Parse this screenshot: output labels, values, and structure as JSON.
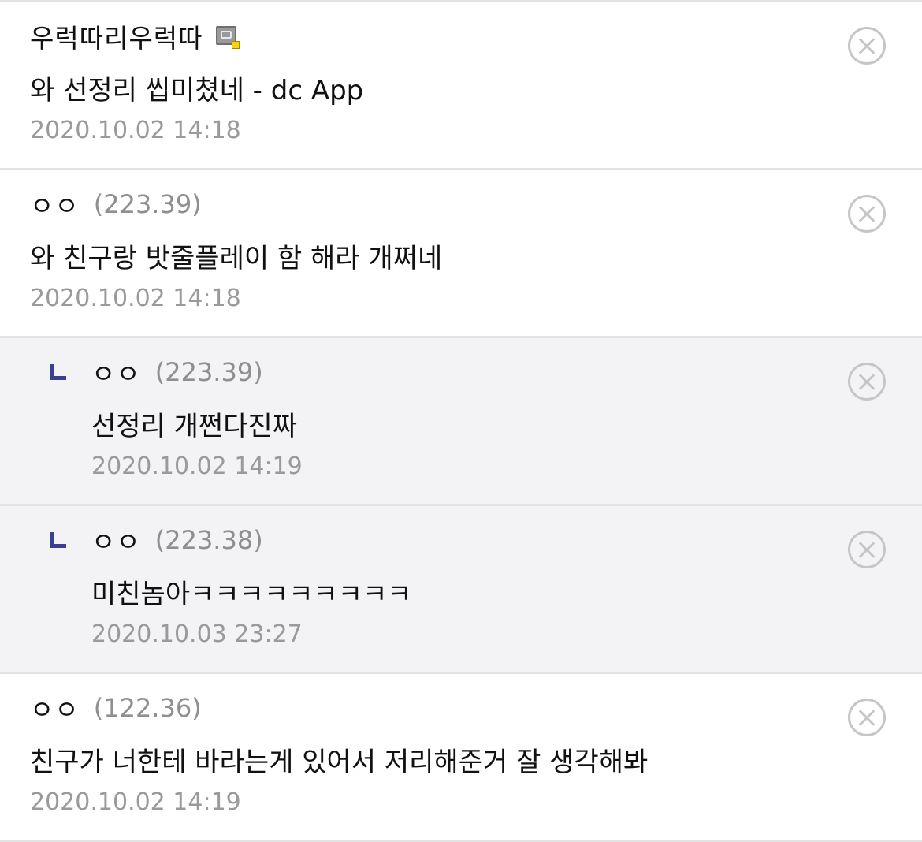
{
  "comments": [
    {
      "nickname": "우럭따리우럭따",
      "ip": "",
      "has_gallog_icon": true,
      "icon": "gallog-icon",
      "text": "와 선정리 씹미쳤네 - dc App",
      "date": "2020.10.02 14:18",
      "is_reply": false
    },
    {
      "nickname": "ㅇㅇ",
      "ip": "(223.39)",
      "text": "와 친구랑 밧줄플레이 함 해라 개쩌네",
      "date": "2020.10.02 14:18",
      "is_reply": false
    },
    {
      "nickname": "ㅇㅇ",
      "ip": "(223.39)",
      "text": "선정리 개쩐다진짜",
      "date": "2020.10.02 14:19",
      "is_reply": true
    },
    {
      "nickname": "ㅇㅇ",
      "ip": "(223.38)",
      "text": "미친놈아ㅋㅋㅋㅋㅋㅋㅋㅋㅋ",
      "date": "2020.10.03 23:27",
      "is_reply": true
    },
    {
      "nickname": "ㅇㅇ",
      "ip": "(122.36)",
      "text": "친구가 너한테 바라는게 있어서 저리해준거 잘 생각해봐",
      "date": "2020.10.02 14:19",
      "is_reply": false
    }
  ],
  "colors": {
    "reply_background": "#f3f3f6",
    "reply_marker": "#3b3f8f",
    "divider": "#e3e3e6",
    "meta_text": "#9a9a9a",
    "delete_icon": "#c6c6c9"
  },
  "icons": {
    "delete": "close-circle-icon",
    "reply_marker": "reply-arrow-icon"
  }
}
